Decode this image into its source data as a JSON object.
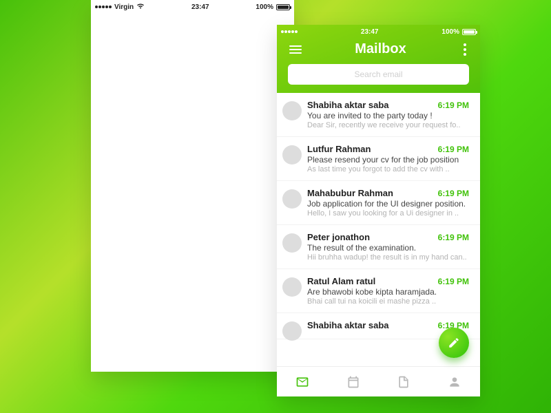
{
  "status": {
    "carrier": "Virgin",
    "time": "23:47",
    "battery": "100%"
  },
  "mailbox": {
    "title": "Mailbox",
    "search_placeholder": "Search email"
  },
  "emails": [
    {
      "sender": "Shabiha aktar saba",
      "time": "6:19 PM",
      "subject": "You are invited to the party today !",
      "preview": "Dear Sir, recently we receive your request fo.."
    },
    {
      "sender": "Lutfur Rahman",
      "time": "6:19 PM",
      "subject": "Please resend your cv for the job position",
      "preview": "As last time you forgot to add the cv with .."
    },
    {
      "sender": "Mahabubur Rahman",
      "time": "6:19 PM",
      "subject": "Job application for the UI designer position.",
      "preview": "Hello, I saw you looking for a Ui designer in .."
    },
    {
      "sender": "Peter jonathon",
      "time": "6:19 PM",
      "subject": "The result of the examination.",
      "preview": "Hii bruhha wadup! the result is in my hand can.."
    },
    {
      "sender": "Ratul Alam ratul",
      "time": "6:19 PM",
      "subject": "Are bhawobi kobe kipta haramjada.",
      "preview": "Bhai call tui na koicili ei mashe pizza .."
    },
    {
      "sender": "Shabiha aktar saba",
      "time": "6:19 PM",
      "subject": "",
      "preview": ""
    }
  ],
  "accent": "#45c20a"
}
